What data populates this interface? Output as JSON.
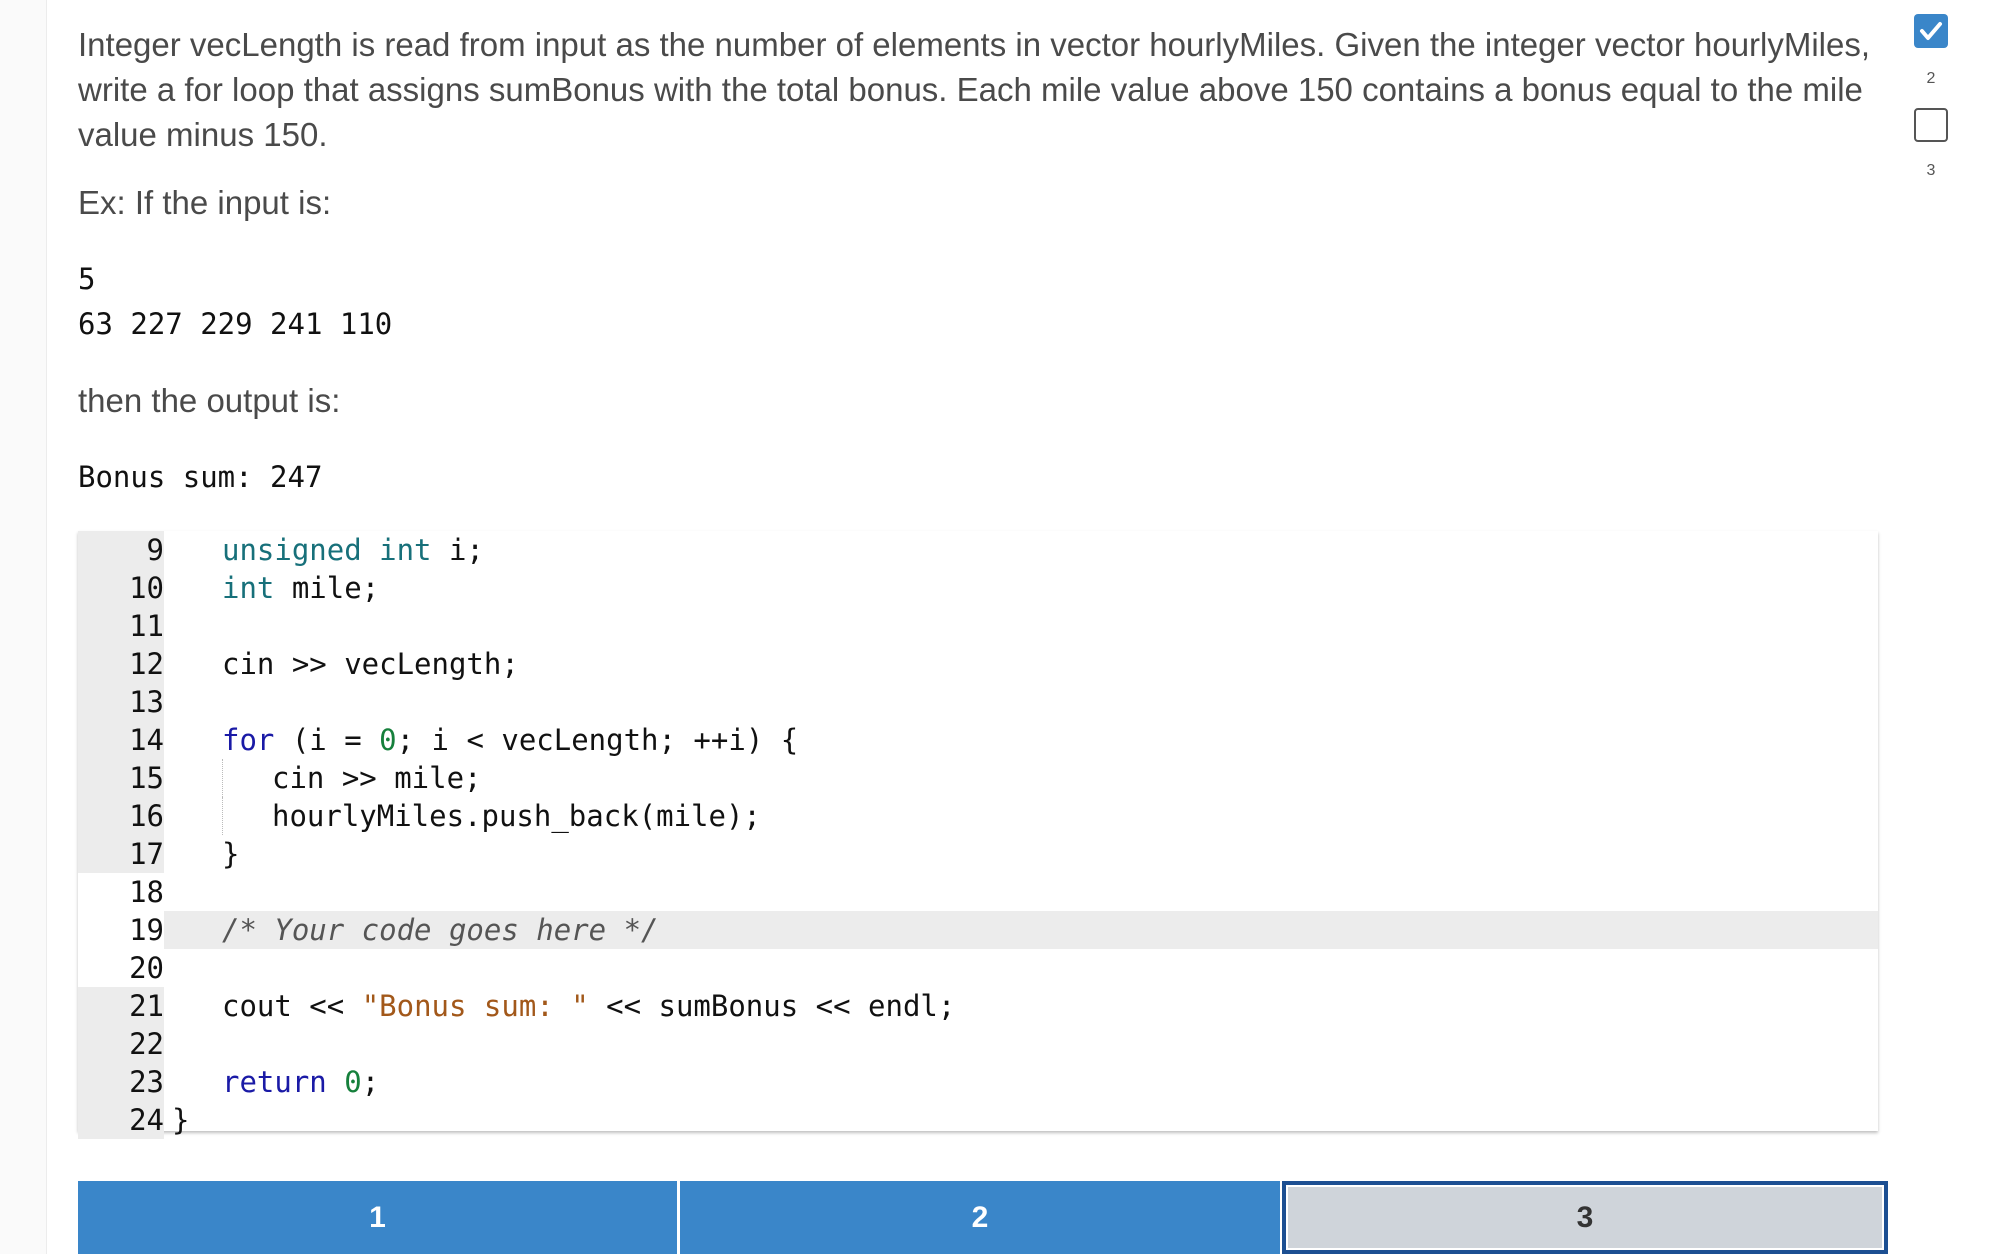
{
  "prompt": {
    "text": "Integer vecLength is read from input as the number of elements in vector hourlyMiles. Given the integer vector hourlyMiles, write a for loop that assigns sumBonus with the total bonus. Each mile value above 150 contains a bonus equal to the mile value minus 150.",
    "example_label": "Ex: If the input is:",
    "input_line1": "5",
    "input_line2": "63 227 229 241 110",
    "then_label": "then the output is:",
    "output": "Bonus sum: 247"
  },
  "editor": {
    "lines": [
      {
        "num": "9",
        "code": "   unsigned int i;"
      },
      {
        "num": "10",
        "code": "   int mile;"
      },
      {
        "num": "11",
        "code": ""
      },
      {
        "num": "12",
        "code": "   cin >> vecLength;"
      },
      {
        "num": "13",
        "code": ""
      },
      {
        "num": "14",
        "code": "   for (i = 0; i < vecLength; ++i) {"
      },
      {
        "num": "15",
        "code": "      cin >> mile;"
      },
      {
        "num": "16",
        "code": "      hourlyMiles.push_back(mile);"
      },
      {
        "num": "17",
        "code": "   }"
      },
      {
        "num": "18",
        "code": ""
      },
      {
        "num": "19",
        "code": "   /* Your code goes here */"
      },
      {
        "num": "20",
        "code": ""
      },
      {
        "num": "21",
        "code": "   cout << \"Bonus sum: \" << sumBonus << endl;"
      },
      {
        "num": "22",
        "code": ""
      },
      {
        "num": "23",
        "code": "   return 0;"
      },
      {
        "num": "24",
        "code": "}"
      }
    ]
  },
  "progress": {
    "steps": [
      {
        "label": "1",
        "state": "done"
      },
      {
        "label": "2",
        "state": "done"
      },
      {
        "label": "3",
        "state": "current"
      }
    ]
  },
  "side_checks": {
    "items": [
      {
        "label": "2",
        "checked": true
      },
      {
        "label": "3",
        "checked": false
      }
    ]
  },
  "colors": {
    "accent": "#3a86c9",
    "current_border": "#1c4f92",
    "keyword_teal": "#17707a",
    "keyword_blue": "#1a1aa6",
    "string": "#a2581a",
    "number": "#16803c"
  }
}
